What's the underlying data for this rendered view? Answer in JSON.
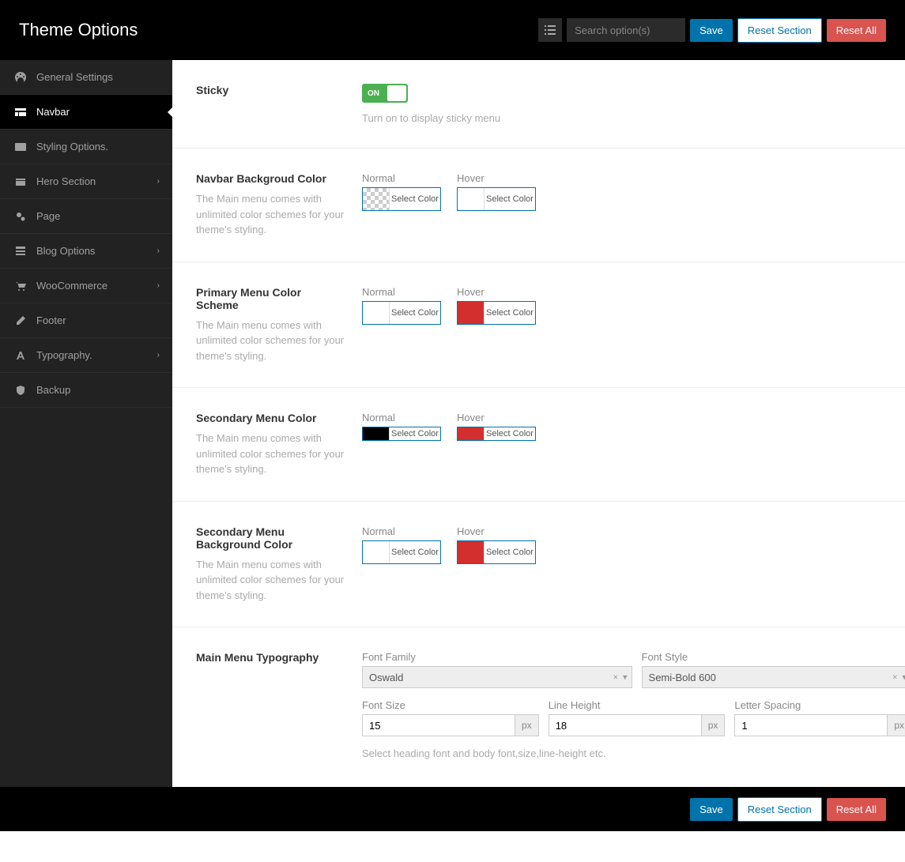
{
  "topbar": {
    "title": "Theme Options",
    "search_placeholder": "Search option(s)",
    "save": "Save",
    "reset_section": "Reset Section",
    "reset_all": "Reset All"
  },
  "sidebar": {
    "items": [
      {
        "label": "General Settings",
        "icon": "dashboard",
        "chevron": false
      },
      {
        "label": "Navbar",
        "icon": "navbar",
        "chevron": false,
        "active": true
      },
      {
        "label": "Styling Options.",
        "icon": "styling",
        "chevron": false
      },
      {
        "label": "Hero Section",
        "icon": "hero",
        "chevron": true
      },
      {
        "label": "Page",
        "icon": "cogs",
        "chevron": false
      },
      {
        "label": "Blog Options",
        "icon": "blog",
        "chevron": true
      },
      {
        "label": "WooCommerce",
        "icon": "cart",
        "chevron": true
      },
      {
        "label": "Footer",
        "icon": "edit",
        "chevron": false
      },
      {
        "label": "Typography.",
        "icon": "font",
        "chevron": true
      },
      {
        "label": "Backup",
        "icon": "shield",
        "chevron": false
      }
    ]
  },
  "sections": {
    "sticky": {
      "title": "Sticky",
      "toggle_on": "ON",
      "help": "Turn on to display sticky menu"
    },
    "navbar_bg": {
      "title": "Navbar Backgroud Color",
      "desc": "The Main menu comes with unlimited color schemes for your theme's styling.",
      "normal_label": "Normal",
      "hover_label": "Hover",
      "select_color": "Select Color",
      "normal_swatch": "transparent",
      "hover_swatch": "white"
    },
    "primary_color": {
      "title": "Primary Menu Color Scheme",
      "desc": "The Main menu comes with unlimited color schemes for your theme's styling.",
      "normal_label": "Normal",
      "hover_label": "Hover",
      "select_color": "Select Color",
      "normal_swatch": "white",
      "hover_swatch": "red"
    },
    "secondary_color": {
      "title": "Secondary Menu Color",
      "desc": "The Main menu comes with unlimited color schemes for your theme's styling.",
      "normal_label": "Normal",
      "hover_label": "Hover",
      "select_color": "Select Color",
      "normal_swatch": "black",
      "hover_swatch": "red"
    },
    "secondary_bg": {
      "title": "Secondary Menu Background Color",
      "desc": "The Main menu comes with unlimited color schemes for your theme's styling.",
      "normal_label": "Normal",
      "hover_label": "Hover",
      "select_color": "Select Color",
      "normal_swatch": "white",
      "hover_swatch": "red"
    },
    "typography": {
      "title": "Main Menu Typography",
      "font_family_label": "Font Family",
      "font_family_value": "Oswald",
      "font_style_label": "Font Style",
      "font_style_value": "Semi-Bold 600",
      "font_size_label": "Font Size",
      "font_size_value": "15",
      "line_height_label": "Line Height",
      "line_height_value": "18",
      "letter_spacing_label": "Letter Spacing",
      "letter_spacing_value": "1",
      "unit": "px",
      "help": "Select heading font and body font,size,line-height etc."
    }
  },
  "bottombar": {
    "save": "Save",
    "reset_section": "Reset Section",
    "reset_all": "Reset All"
  },
  "colors": {
    "accent": "#0073aa",
    "danger": "#d9534f",
    "success": "#4caf50"
  }
}
